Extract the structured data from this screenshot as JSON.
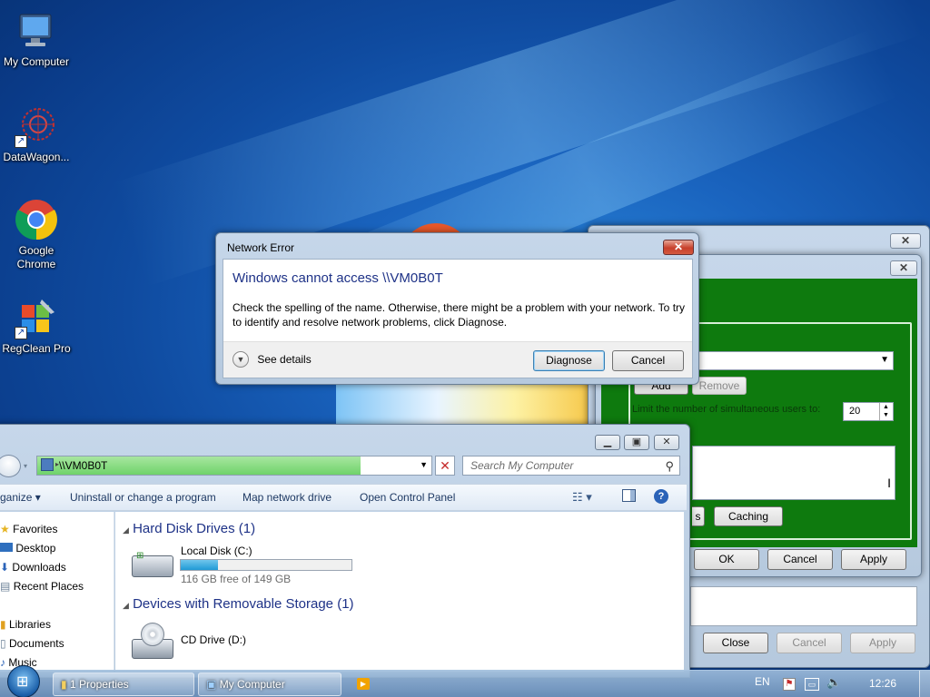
{
  "desktop": {
    "icons": [
      {
        "label": "My Computer"
      },
      {
        "label": "DataWagon..."
      },
      {
        "label": "Google Chrome"
      },
      {
        "label": "RegClean Pro"
      }
    ]
  },
  "network_error": {
    "title": "Network Error",
    "heading": "Windows cannot access \\\\VM0B0T",
    "message": "Check the spelling of the name. Otherwise, there might be a problem with your network. To try to identify and resolve network problems, click Diagnose.",
    "see_details": "See details",
    "diagnose": "Diagnose",
    "cancel": "Cancel",
    "close_glyph": "✕"
  },
  "properties": {
    "add": "Add",
    "remove": "Remove",
    "limit_label": "Limit the number of simultaneous users to:",
    "limit_value": "20",
    "permissions_tail": "s",
    "caching": "Caching",
    "ok": "OK",
    "cancel": "Cancel",
    "apply": "Apply",
    "close": "Close",
    "cancel2": "Cancel",
    "apply2": "Apply",
    "close_glyph": "✕"
  },
  "explorer": {
    "address": "\\\\VM0B0T",
    "search_placeholder": "Search My Computer",
    "commands": [
      "ganize ▾",
      "Uninstall or change a program",
      "Map network drive",
      "Open Control Panel"
    ],
    "nav": {
      "favorites": "Favorites",
      "desktop": "Desktop",
      "downloads": "Downloads",
      "recent": "Recent Places",
      "libraries": "Libraries",
      "documents": "Documents",
      "music": "Music"
    },
    "hdd_group": "Hard Disk Drives (1)",
    "local_disk": "Local Disk (C:)",
    "disk_free": "116 GB free of 149 GB",
    "disk_used_fraction": 0.22,
    "removable_group": "Devices with Removable Storage (1)",
    "cd_drive": "CD Drive (D:)"
  },
  "taskbar": {
    "items": [
      "1 Properties",
      "My Computer"
    ],
    "lang": "EN",
    "time": "12:26"
  }
}
